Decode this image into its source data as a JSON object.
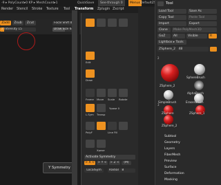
{
  "topbar": {
    "poly": "-9 ▸ PolyCount▸0 KP ▸ MeshCount▸1",
    "quicksave": "QuickSave",
    "seethrough": "See-through 0",
    "menus": "Menus",
    "ui": "DefaultZScript"
  },
  "menubar": {
    "items": [
      "Render",
      "Stencil",
      "Stroke",
      "Texture",
      "Tool",
      "Transform",
      "Zplugin",
      "Zscript"
    ],
    "active": "Transform"
  },
  "toolbar": {
    "zadd": "Zadd",
    "zsub": "Zsub",
    "zcut": "Zcut",
    "focal_shift": "Focal Shift 0",
    "draw_size": "Draw Size 64",
    "z_intensity": "Z Intensity 15"
  },
  "canvas": {
    "tooltip": "Y Symmetry"
  },
  "transform": {
    "icons": [
      "Edit",
      "Draw",
      "Move",
      "Scale",
      "Rotate",
      "Frame",
      "Local",
      "Transp",
      "L.Sym",
      "Xpose",
      "Line Fill",
      "PolyF"
    ],
    "activate_symmetry": "Activate Symmetry",
    "axes": [
      "> X <",
      "> Y <",
      "> Z <",
      "(M)"
    ],
    "localsym": "LocalSym",
    "radial": "Radial",
    "radial_count": "8",
    "ypose": "Ypose 0"
  },
  "tool": {
    "title": "Tool",
    "load": "Load Tool",
    "saveas": "Save As",
    "copy": "Copy Tool",
    "paste": "Paste Tool",
    "import": "Import",
    "export": "Export",
    "clone": "Clone",
    "make_polymesh": "Make PolyMesh3D",
    "goz": "GoZ",
    "all": "All",
    "visible": "Visible",
    "r": "R",
    "lightbox": "Lightbox ▸ Tools",
    "current": "ZSphere_2",
    "current_count": "48",
    "thumbs": [
      "ZSphere_2",
      "SphereBrush",
      "AlphaBrush",
      "SimpleBrush",
      "EraserBrush",
      "ZSphere",
      "ZSphere_1",
      "ZSphere_2"
    ],
    "badges": [
      "2",
      "3"
    ],
    "sections": [
      "Subtool",
      "Geometry",
      "Layers",
      "FiberMesh",
      "Preview",
      "Surface",
      "Deformation",
      "Masking"
    ]
  },
  "colors": {
    "accent": "#ec8f1d",
    "panel": "#2a2a2a",
    "text": "#d8d8d8"
  }
}
